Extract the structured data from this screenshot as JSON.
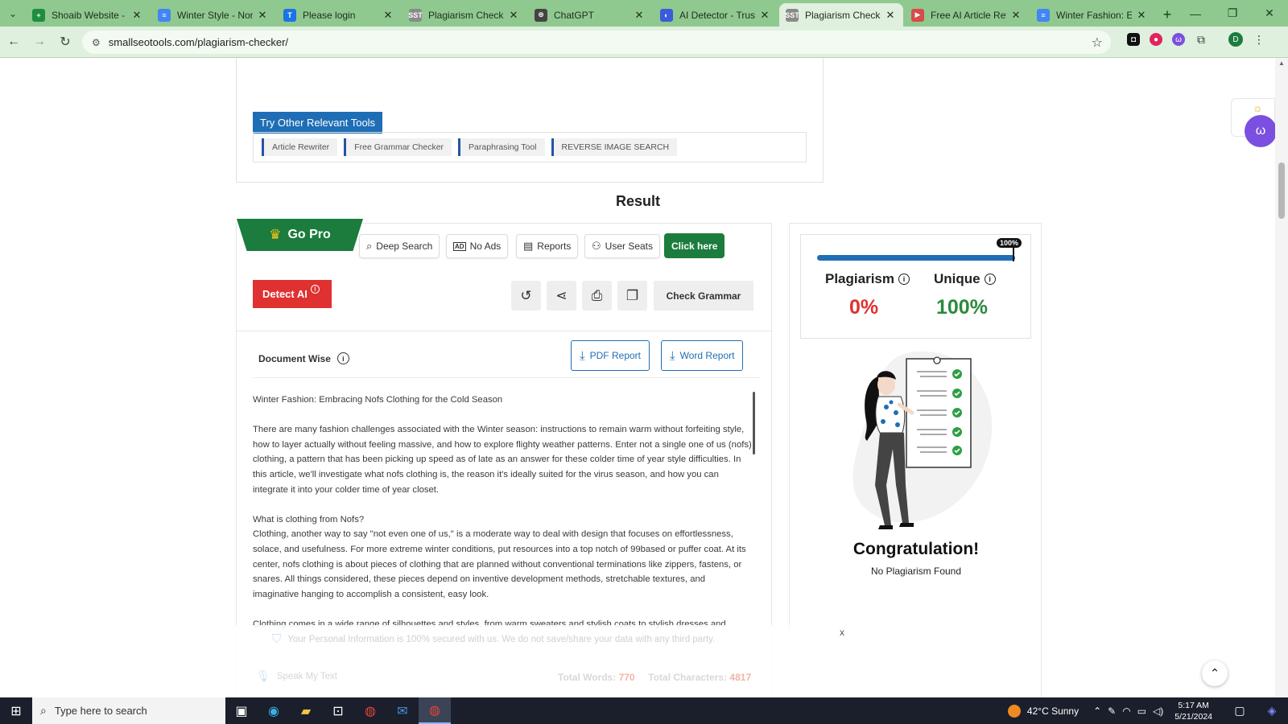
{
  "browser": {
    "tabs": [
      {
        "title": "Shoaib Website - Go",
        "favicon_color": "#1e8e3e",
        "favicon_glyph": "+",
        "active": false
      },
      {
        "title": "Winter Style - None C",
        "favicon_color": "#4285f4",
        "favicon_glyph": "≡",
        "active": false
      },
      {
        "title": "Please login",
        "favicon_color": "#1a73e8",
        "favicon_glyph": "T",
        "active": false
      },
      {
        "title": "Plagiarism Checker -",
        "favicon_color": "#8a8a8a",
        "favicon_glyph": "SST",
        "active": false
      },
      {
        "title": "ChatGPT",
        "favicon_color": "#444444",
        "favicon_glyph": "⊛",
        "active": false
      },
      {
        "title": "AI Detector - Trusted",
        "favicon_color": "#3b5bdb",
        "favicon_glyph": "◐",
        "active": false
      },
      {
        "title": "Plagiarism Checker -",
        "favicon_color": "#8a8a8a",
        "favicon_glyph": "SST",
        "active": true
      },
      {
        "title": "Free AI Article Rewrit",
        "favicon_color": "#d94a4a",
        "favicon_glyph": "▶",
        "active": false
      },
      {
        "title": "Winter Fashion: Emb",
        "favicon_color": "#4285f4",
        "favicon_glyph": "≡",
        "active": false
      }
    ],
    "url": "smallseotools.com/plagiarism-checker/",
    "profile_initial": "D"
  },
  "tools": {
    "title": "Try Other Relevant Tools",
    "items": [
      "Article Rewriter",
      "Free Grammar Checker",
      "Paraphrasing Tool",
      "REVERSE IMAGE SEARCH"
    ]
  },
  "result": {
    "title": "Result",
    "go_pro": "Go Pro",
    "features": [
      "Deep Search",
      "No Ads",
      "Reports",
      "User Seats"
    ],
    "feature_icons": [
      "search-icon",
      "no-ads-icon",
      "reports-icon",
      "user-seats-icon"
    ],
    "click_here": "Click here",
    "detect_ai": "Detect AI",
    "check_grammar": "Check Grammar",
    "document_wise": "Document Wise",
    "pdf_report": "PDF Report",
    "word_report": "Word Report",
    "document": {
      "title": "Winter Fashion: Embracing Nofs Clothing for the Cold Season",
      "p1": "There are many fashion challenges associated with the Winter season: instructions to remain warm without forfeiting style, how to layer actually without feeling massive, and how to explore flighty weather patterns. Enter not a single one of us (nofs) clothing, a pattern that has been picking up speed as of late as an answer for these colder time of year style difficulties. In this article, we'll investigate what nofs clothing is, the reason it's ideally suited for the virus season, and how you can integrate it into your colder time of year closet.",
      "h2": "What is clothing from Nofs?",
      "p2": "Clothing, another way to say \"not even one of us,\" is a moderate way to deal with design that focuses on effortlessness, solace, and usefulness. For more extreme winter conditions, put resources into a top notch of 99based or puffer coat. At its center, nofs clothing is about pieces of clothing that are planned without conventional terminations like zippers, fastens, or snares. All things considered, these pieces depend on inventive development methods, stretchable textures, and imaginative hanging to accomplish a consistent, easy look.",
      "p3": "Clothing comes in a wide range of silhouettes and styles, from warm sweaters and stylish coats to stylish dresses and"
    }
  },
  "score": {
    "bar_percent": 100,
    "bar_badge": "100%",
    "plagiarism_label": "Plagiarism",
    "plagiarism_value": "0%",
    "plagiarism_color": "#e03131",
    "unique_label": "Unique",
    "unique_value": "100%",
    "unique_color": "#2b8a3e",
    "congrats": "Congratulation!",
    "no_plagiarism": "No Plagiarism Found"
  },
  "footer": {
    "secure": "Your Personal Information is 100% secured with us. We do not save/share your data with any third party.",
    "close": "x",
    "speak": "Speak My Text",
    "total_words_label": "Total Words:",
    "total_words": "770",
    "total_chars_label": "Total Characters:",
    "total_chars": "4817"
  },
  "taskbar": {
    "search_placeholder": "Type here to search",
    "weather": "42°C  Sunny",
    "time": "5:17 AM",
    "date": "5/21/2024"
  }
}
